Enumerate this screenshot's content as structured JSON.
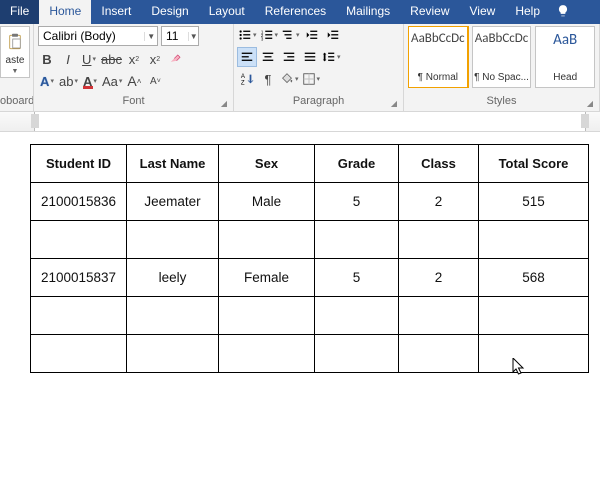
{
  "tabs": {
    "file": "File",
    "home": "Home",
    "insert": "Insert",
    "design": "Design",
    "layout": "Layout",
    "references": "References",
    "mailings": "Mailings",
    "review": "Review",
    "view": "View",
    "help": "Help"
  },
  "clipboard": {
    "paste": "aste",
    "label": "oboard"
  },
  "font": {
    "name": "Calibri (Body)",
    "size": "11",
    "label": "Font"
  },
  "paragraph": {
    "label": "Paragraph"
  },
  "styles": {
    "label": "Styles",
    "preview": "AaBbCcDc",
    "preview_heading": "AaB",
    "normal": "¶ Normal",
    "nospacing": "¶ No Spac...",
    "heading1": "Head"
  },
  "table": {
    "headers": [
      "Student ID",
      "Last Name",
      "Sex",
      "Grade",
      "Class",
      "Total Score"
    ],
    "rows": [
      [
        "2100015836",
        "Jeemater",
        "Male",
        "5",
        "2",
        "515"
      ],
      [
        "",
        "",
        "",
        "",
        "",
        ""
      ],
      [
        "2100015837",
        "leely",
        "Female",
        "5",
        "2",
        "568"
      ],
      [
        "",
        "",
        "",
        "",
        "",
        ""
      ],
      [
        "",
        "",
        "",
        "",
        "",
        ""
      ]
    ]
  },
  "colors": {
    "highlight": "#ffff00",
    "fontcolor": "#d13438",
    "shading": "#e0e0e0"
  }
}
